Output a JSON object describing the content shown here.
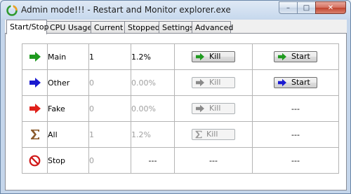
{
  "window": {
    "title": "Admin mode!!! - Restart and Monitor explorer.exe",
    "controls": {
      "minimize": "–",
      "maximize": "□",
      "close": "✕"
    }
  },
  "tabs": [
    {
      "label": "Start/Stop",
      "active": true
    },
    {
      "label": "CPU Usage",
      "active": false
    },
    {
      "label": "Current",
      "active": false
    },
    {
      "label": "Stopped",
      "active": false
    },
    {
      "label": "Settings",
      "active": false
    },
    {
      "label": "Advanced",
      "active": false
    }
  ],
  "rows": [
    {
      "icon": "green-arrow-icon",
      "name": "Main",
      "count": "1",
      "cpu": "1.2%",
      "kill_label": "Kill",
      "kill_enabled": true,
      "start_label": "Start",
      "start_enabled": true,
      "start_icon": "green-arrow-icon"
    },
    {
      "icon": "blue-arrow-icon",
      "name": "Other",
      "count": "0",
      "cpu": "0.00%",
      "kill_label": "Kill",
      "kill_enabled": false,
      "start_label": "Start",
      "start_enabled": true,
      "start_icon": "blue-arrow-icon"
    },
    {
      "icon": "red-arrow-icon",
      "name": "Fake",
      "count": "0",
      "cpu": "0.00%",
      "kill_label": "Kill",
      "kill_enabled": false,
      "start_text": "---"
    },
    {
      "icon": "sigma-icon",
      "name": "All",
      "count": "1",
      "cpu": "1.2%",
      "kill_label": "Kill",
      "kill_enabled": false,
      "start_text": "---"
    },
    {
      "icon": "stop-icon",
      "name": "Stop",
      "count": "0",
      "cpu_text": "---",
      "kill_text": "---",
      "start_text": "---"
    }
  ],
  "colors": {
    "green": "#1f9a1f",
    "blue": "#1a1ad0",
    "red": "#e0201a",
    "sigma": "#8a5a2b",
    "stop": "#d01818",
    "disabled": "#8a8a8a"
  }
}
